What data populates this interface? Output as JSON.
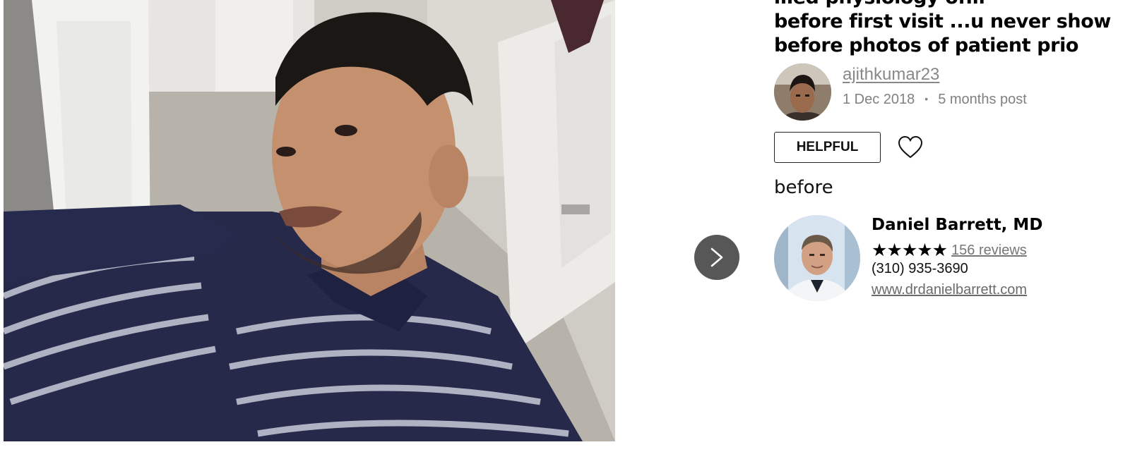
{
  "review": {
    "title_lines": [
      "…ed physiology of…",
      "before first visit ...u never show",
      "before photos of patient prio"
    ],
    "reviewer": {
      "username": "ajithkumar23",
      "date": "1 Dec 2018",
      "separator": "•",
      "post_type": "5 months post"
    },
    "helpful_label": "HELPFUL",
    "body": "before"
  },
  "doctor": {
    "name": "Daniel Barrett, MD",
    "stars": "★★★★★",
    "rating": 5,
    "reviews_label": "156 reviews",
    "phone": "(310) 935-3690",
    "website": "www.drdanielbarrett.com"
  },
  "icons": {
    "next": "chevron-right-icon",
    "favorite": "heart-outline-icon",
    "rating": "star-icon"
  },
  "colors": {
    "next_button": "#575757",
    "muted_text": "#808080",
    "photo_shirt": "#26294a"
  }
}
